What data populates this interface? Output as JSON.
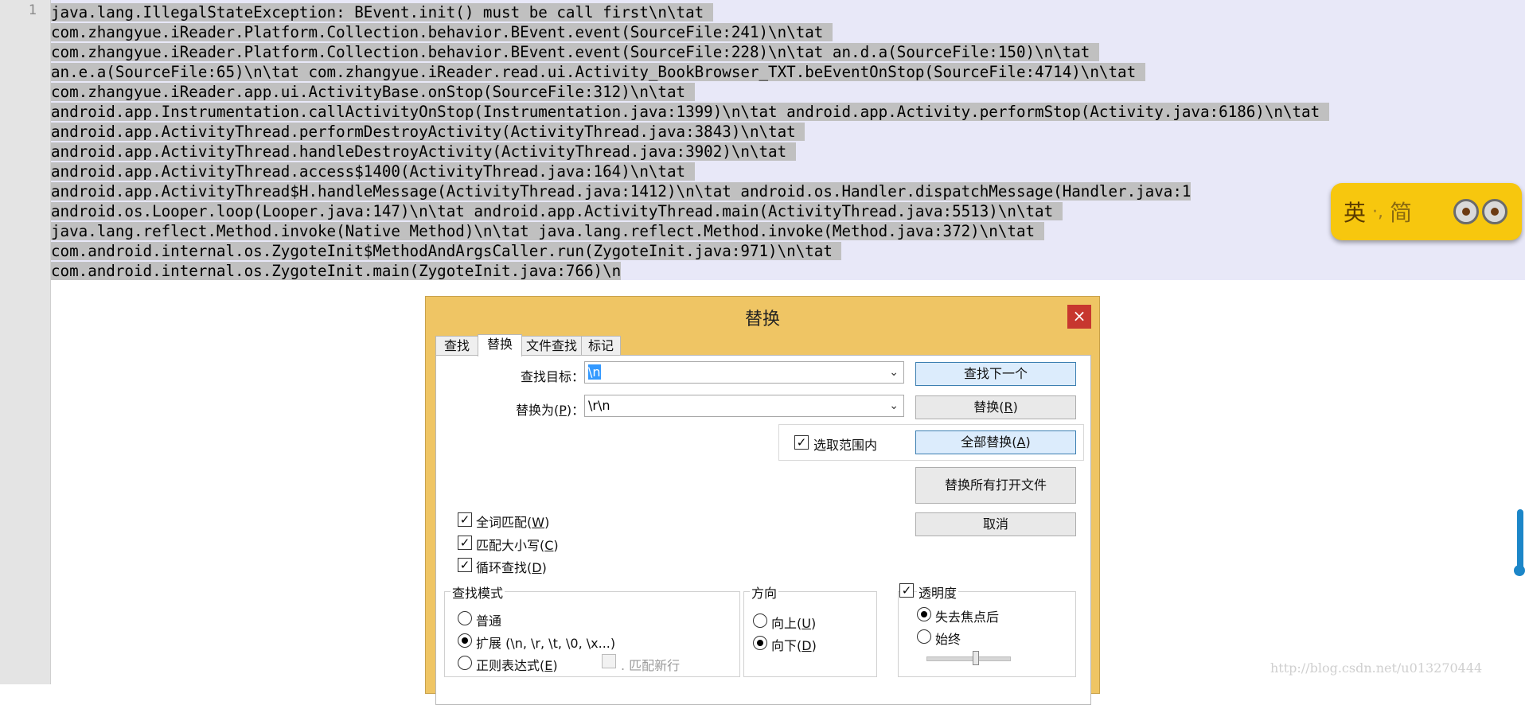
{
  "editor": {
    "line_number": "1",
    "lines": [
      "java.lang.IllegalStateException: BEvent.init() must be call first\\n\\tat ",
      "com.zhangyue.iReader.Platform.Collection.behavior.BEvent.event(SourceFile:241)\\n\\tat ",
      "com.zhangyue.iReader.Platform.Collection.behavior.BEvent.event(SourceFile:228)\\n\\tat an.d.a(SourceFile:150)\\n\\tat ",
      "an.e.a(SourceFile:65)\\n\\tat com.zhangyue.iReader.read.ui.Activity_BookBrowser_TXT.beEventOnStop(SourceFile:4714)\\n\\tat ",
      "com.zhangyue.iReader.app.ui.ActivityBase.onStop(SourceFile:312)\\n\\tat ",
      "android.app.Instrumentation.callActivityOnStop(Instrumentation.java:1399)\\n\\tat android.app.Activity.performStop(Activity.java:6186)\\n\\tat ",
      "android.app.ActivityThread.performDestroyActivity(ActivityThread.java:3843)\\n\\tat ",
      "android.app.ActivityThread.handleDestroyActivity(ActivityThread.java:3902)\\n\\tat ",
      "android.app.ActivityThread.access$1400(ActivityThread.java:164)\\n\\tat ",
      "android.app.ActivityThread$H.handleMessage(ActivityThread.java:1412)\\n\\tat android.os.Handler.dispatchMessage(Handler.java:1",
      "android.os.Looper.loop(Looper.java:147)\\n\\tat android.app.ActivityThread.main(ActivityThread.java:5513)\\n\\tat ",
      "java.lang.reflect.Method.invoke(Native Method)\\n\\tat java.lang.reflect.Method.invoke(Method.java:372)\\n\\tat ",
      "com.android.internal.os.ZygoteInit$MethodAndArgsCaller.run(ZygoteInit.java:971)\\n\\tat ",
      "com.android.internal.os.ZygoteInit.main(ZygoteInit.java:766)\\n"
    ]
  },
  "ime": {
    "lang": "英",
    "sep": "·,",
    "mode": "简"
  },
  "watermark": "http://blog.csdn.net/u013270444",
  "dialog": {
    "title": "替换",
    "close": "×",
    "tabs": [
      "查找",
      "替换",
      "文件查找",
      "标记"
    ],
    "find_label": "查找目标：",
    "find_value": "\\n",
    "replace_label_pre": "替换为(",
    "replace_label_key": "P",
    "replace_label_post": ")：",
    "replace_value": "\\r\\n",
    "in_selection": "选取范围内",
    "buttons": {
      "find_next": "查找下一个",
      "replace_pre": "替换(",
      "replace_key": "R",
      "replace_post": ")",
      "replace_all_pre": "全部替换(",
      "replace_all_key": "A",
      "replace_all_post": ")",
      "replace_all_open": "替换所有打开文件",
      "cancel": "取消"
    },
    "options": [
      {
        "pre": "全词匹配(",
        "key": "W",
        "post": ")"
      },
      {
        "pre": "匹配大小写(",
        "key": "C",
        "post": ")"
      },
      {
        "pre": "循环查找(",
        "key": "D",
        "post": ")"
      }
    ],
    "search_mode": {
      "title": "查找模式",
      "normal": "普通",
      "extended": "扩展 (\\n, \\r, \\t, \\0, \\x...)",
      "regex_pre": "正则表达式(",
      "regex_key": "E",
      "regex_post": ")",
      "match_newline": ". 匹配新行",
      "selected": "extended"
    },
    "direction": {
      "title": "方向",
      "up_pre": "向上(",
      "up_key": "U",
      "up_post": ")",
      "down_pre": "向下(",
      "down_key": "D",
      "down_post": ")",
      "selected": "down"
    },
    "transparency": {
      "title": "透明度",
      "on_lose_focus": "失去焦点后",
      "always": "始终",
      "selected": "on_lose_focus",
      "level": 0.6
    }
  }
}
